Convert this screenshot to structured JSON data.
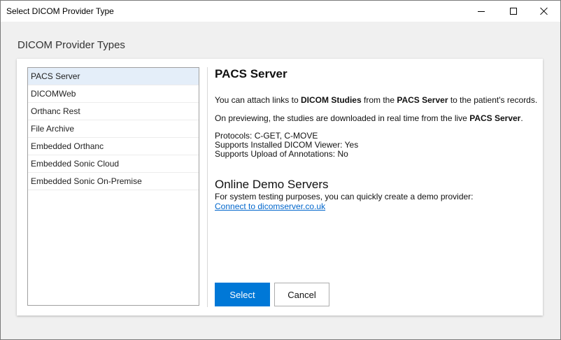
{
  "window": {
    "title": "Select DICOM Provider Type"
  },
  "page": {
    "heading": "DICOM Provider Types"
  },
  "provider_list": {
    "items": [
      {
        "label": "PACS Server",
        "selected": true
      },
      {
        "label": "DICOMWeb",
        "selected": false
      },
      {
        "label": "Orthanc Rest",
        "selected": false
      },
      {
        "label": "File Archive",
        "selected": false
      },
      {
        "label": "Embedded Orthanc",
        "selected": false
      },
      {
        "label": "Embedded Sonic Cloud",
        "selected": false
      },
      {
        "label": "Embedded Sonic On-Premise",
        "selected": false
      }
    ]
  },
  "detail": {
    "title": "PACS Server",
    "para1": {
      "pre": "You can attach links to ",
      "bold1": "DICOM Studies",
      "mid": " from the ",
      "bold2": "PACS Server",
      "post": " to the patient's records."
    },
    "para2": {
      "pre": "On previewing, the studies are downloaded in real time from the live ",
      "bold": "PACS Server",
      "post": "."
    },
    "protocols": "Protocols: C-GET, C-MOVE",
    "supports_viewer": "Supports Installed DICOM Viewer: Yes",
    "supports_upload": "Supports Upload of Annotations: No",
    "demo_heading": "Online Demo Servers",
    "demo_text": "For system testing purposes, you can quickly create a demo provider:",
    "demo_link": "Connect to dicomserver.co.uk"
  },
  "buttons": {
    "select_label": "Select",
    "cancel_label": "Cancel"
  },
  "colors": {
    "accent": "#0078d7",
    "selected_row": "#e4eef9",
    "link": "#0066cc"
  },
  "icons": [
    "minimize-icon",
    "maximize-icon",
    "close-icon"
  ]
}
